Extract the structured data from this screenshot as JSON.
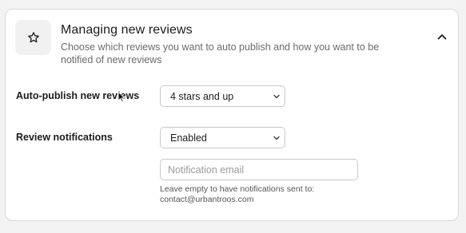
{
  "section": {
    "icon": "star-icon",
    "title": "Managing new reviews",
    "description": "Choose which reviews you want to auto publish and how you want to be notified of new reviews",
    "collapse_icon": "chevron-up-icon"
  },
  "auto_publish": {
    "label": "Auto-publish new reviews",
    "selected": "4 stars and up"
  },
  "notifications": {
    "label": "Review notifications",
    "selected": "Enabled",
    "email_placeholder": "Notification email",
    "email_value": "",
    "help_line1": "Leave empty to have notifications sent to:",
    "help_line2": "contact@urbantroos.com"
  },
  "colors": {
    "card_background": "#ffffff",
    "page_background": "#f3f3f4",
    "text_primary": "#1c1c1e",
    "text_secondary": "#6b6b70"
  }
}
